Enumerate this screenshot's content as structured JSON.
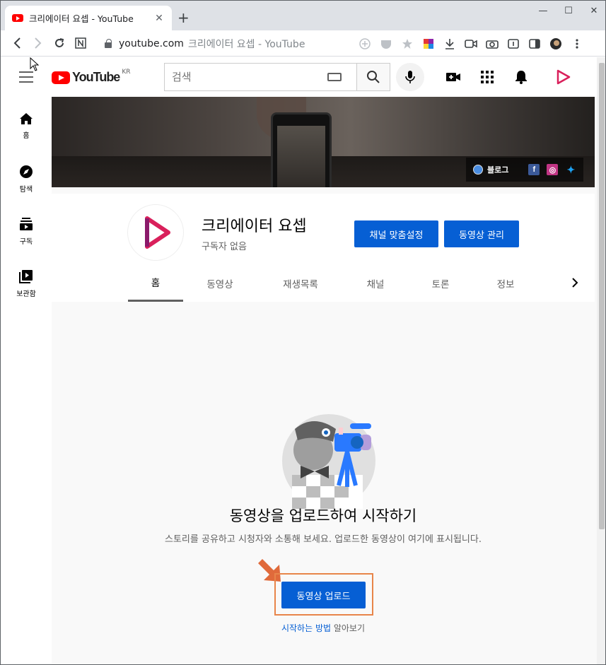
{
  "browser": {
    "tab_title": "크리에이터 요셉 - YouTube",
    "tab_close": "✕",
    "new_tab": "+",
    "url_host": "youtube.com",
    "url_rest": "크리에이터 요셉 - YouTube",
    "window_controls": [
      "—",
      "☐",
      "✕"
    ]
  },
  "header": {
    "logo_text": "YouTube",
    "logo_region": "KR",
    "search_placeholder": "검색"
  },
  "guide": {
    "items": [
      {
        "label": "홈",
        "icon": "home-icon"
      },
      {
        "label": "탐색",
        "icon": "explore-icon"
      },
      {
        "label": "구독",
        "icon": "subscriptions-icon"
      },
      {
        "label": "보관함",
        "icon": "library-icon"
      }
    ]
  },
  "banner": {
    "link_label": "블로그"
  },
  "channel": {
    "name": "크리에이터 요셉",
    "subscribers": "구독자 없음",
    "customize_button": "채널 맞춤설정",
    "manage_button": "동영상 관리",
    "tabs": [
      "홈",
      "동영상",
      "재생목록",
      "채널",
      "토론",
      "정보"
    ],
    "active_tab": "홈"
  },
  "empty_state": {
    "title": "동영상을 업로드하여 시작하기",
    "description": "스토리를 공유하고 시청자와 소통해 보세요. 업로드한 동영상이 여기에 표시됩니다.",
    "upload_button": "동영상 업로드",
    "learn_link": "시작하는 방법",
    "learn_suffix": " 알아보기"
  },
  "colors": {
    "accent": "#065fd4",
    "brand": "#ff0000",
    "highlight": "#e8854a"
  }
}
